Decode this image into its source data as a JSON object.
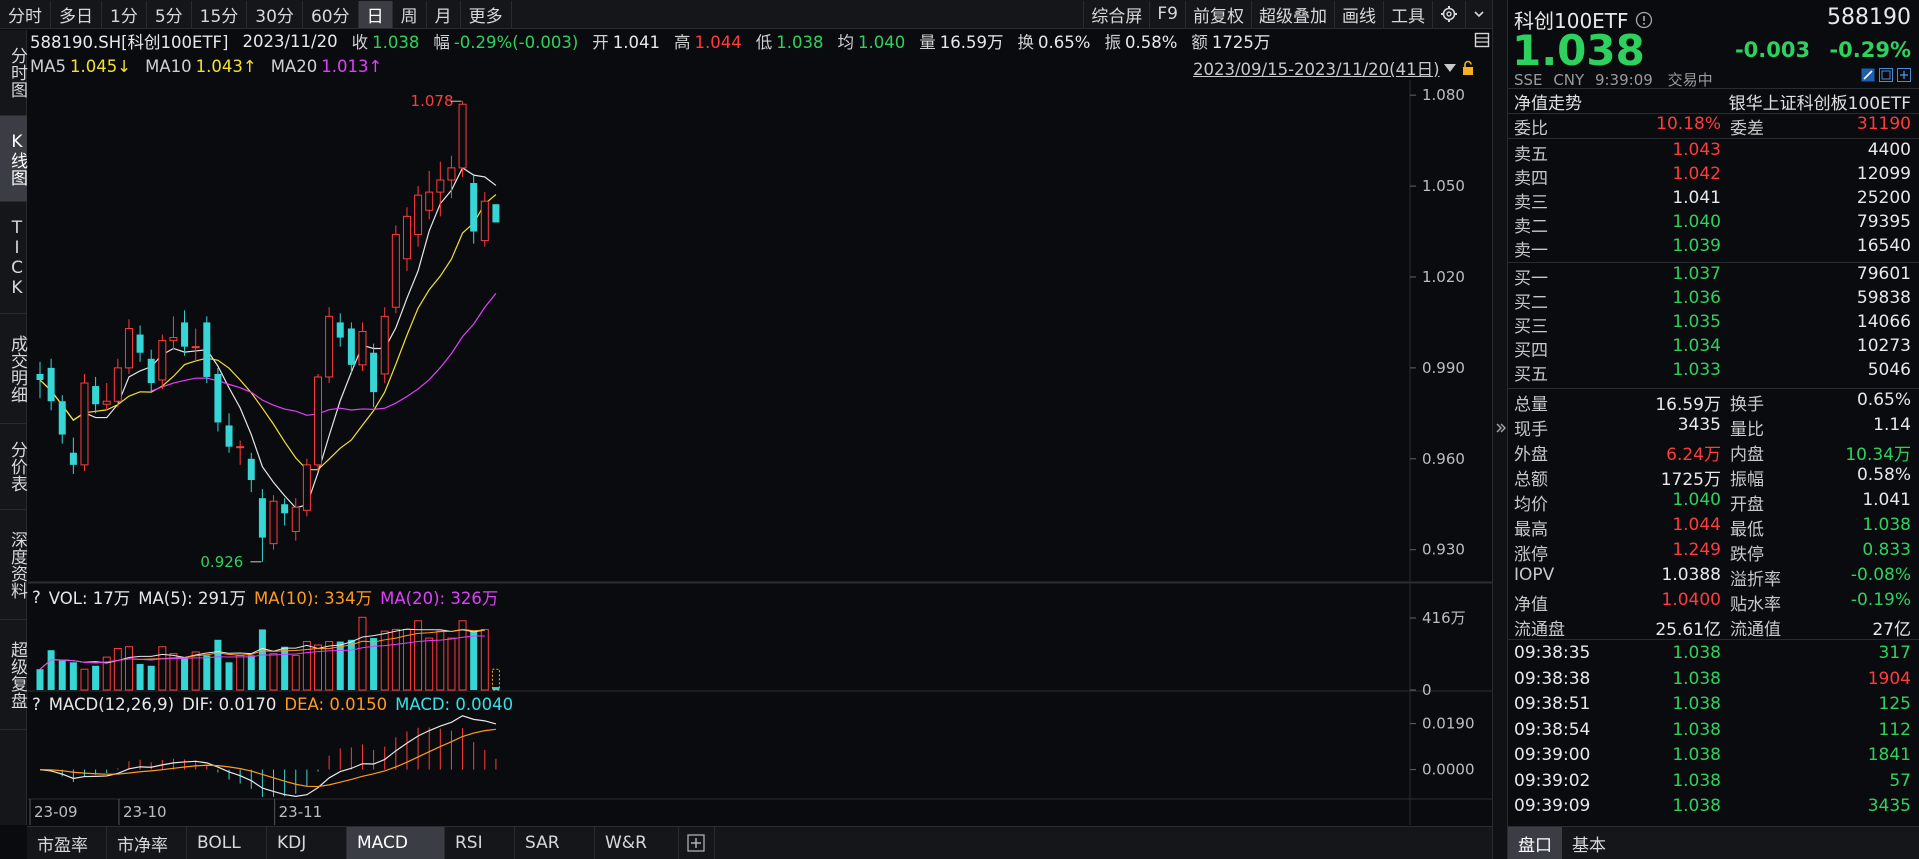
{
  "toolbar": {
    "periods": [
      "分时",
      "多日",
      "1分",
      "5分",
      "15分",
      "30分",
      "60分",
      "日",
      "周",
      "月",
      "更多"
    ],
    "active_period": "日",
    "tools": [
      "综合屏",
      "F9",
      "前复权",
      "超级叠加",
      "画线",
      "工具"
    ]
  },
  "left_tabs": [
    "分时图",
    "K线图",
    "TICK",
    "成交明细",
    "分价表",
    "深度资料",
    "超级复盘"
  ],
  "info": {
    "symbol": "588190.SH[科创100ETF]",
    "date": "2023/11/20",
    "close_label": "收",
    "close": "1.038",
    "change_label": "幅",
    "change": "-0.29%(-0.003)",
    "open_label": "开",
    "open": "1.041",
    "high_label": "高",
    "high": "1.044",
    "low_label": "低",
    "low": "1.038",
    "avg_label": "均",
    "avg": "1.040",
    "volume_label": "量",
    "volume": "16.59万",
    "turnover_label": "换",
    "turnover": "0.65%",
    "amp_label": "振",
    "amp": "0.58%",
    "amount_label": "额",
    "amount": "1725万"
  },
  "ma": {
    "ma5_label": "MA5",
    "ma5": "1.045↓",
    "ma10_label": "MA10",
    "ma10": "1.043↑",
    "ma20_label": "MA20",
    "ma20": "1.013↑"
  },
  "range_label": "2023/09/15-2023/11/20(41日)",
  "vol_info": {
    "q": "?",
    "vol": "VOL: 17万",
    "ma5": "MA(5): 291万",
    "ma10": "MA(10): 334万",
    "ma20": "MA(20): 326万"
  },
  "macd_info": {
    "q": "?",
    "title": "MACD(12,26,9)",
    "dif": "DIF: 0.0170",
    "dea": "DEA: 0.0150",
    "macd": "MACD: 0.0040"
  },
  "price_ticks": [
    "1.080",
    "1.050",
    "1.020",
    "0.990",
    "0.960",
    "0.930"
  ],
  "vol_ticks": [
    "416万",
    "0"
  ],
  "macd_ticks": [
    "0.0190",
    "0.0000"
  ],
  "date_ticks": [
    "23-09",
    "23-10",
    "23-11"
  ],
  "annotations": {
    "high": "1.078",
    "low": "0.926"
  },
  "chart_data": {
    "type": "candlestick",
    "title": "",
    "ylim": [
      0.92,
      1.085
    ],
    "candles": [
      {
        "o": 0.988,
        "c": 0.986,
        "h": 0.992,
        "l": 0.98
      },
      {
        "o": 0.99,
        "c": 0.979,
        "h": 0.993,
        "l": 0.976
      },
      {
        "o": 0.979,
        "c": 0.968,
        "h": 0.981,
        "l": 0.965
      },
      {
        "o": 0.962,
        "c": 0.958,
        "h": 0.967,
        "l": 0.955
      },
      {
        "o": 0.958,
        "c": 0.985,
        "h": 0.988,
        "l": 0.956
      },
      {
        "o": 0.984,
        "c": 0.978,
        "h": 0.987,
        "l": 0.975
      },
      {
        "o": 0.978,
        "c": 0.979,
        "h": 0.985,
        "l": 0.976
      },
      {
        "o": 0.979,
        "c": 0.99,
        "h": 0.993,
        "l": 0.977
      },
      {
        "o": 0.99,
        "c": 1.003,
        "h": 1.006,
        "l": 0.988
      },
      {
        "o": 1.001,
        "c": 0.995,
        "h": 1.004,
        "l": 0.992
      },
      {
        "o": 0.993,
        "c": 0.985,
        "h": 0.996,
        "l": 0.982
      },
      {
        "o": 0.986,
        "c": 0.999,
        "h": 1.001,
        "l": 0.983
      },
      {
        "o": 0.999,
        "c": 1.0,
        "h": 1.007,
        "l": 0.996
      },
      {
        "o": 1.005,
        "c": 0.997,
        "h": 1.009,
        "l": 0.994
      },
      {
        "o": 0.997,
        "c": 0.997,
        "h": 1.003,
        "l": 0.992
      },
      {
        "o": 1.005,
        "c": 0.987,
        "h": 1.007,
        "l": 0.985
      },
      {
        "o": 0.988,
        "c": 0.972,
        "h": 0.99,
        "l": 0.969
      },
      {
        "o": 0.971,
        "c": 0.964,
        "h": 0.975,
        "l": 0.962
      },
      {
        "o": 0.964,
        "c": 0.964,
        "h": 0.966,
        "l": 0.958
      },
      {
        "o": 0.96,
        "c": 0.953,
        "h": 0.962,
        "l": 0.949
      },
      {
        "o": 0.947,
        "c": 0.934,
        "h": 0.95,
        "l": 0.926
      },
      {
        "o": 0.932,
        "c": 0.946,
        "h": 0.948,
        "l": 0.93
      },
      {
        "o": 0.945,
        "c": 0.942,
        "h": 0.947,
        "l": 0.938
      },
      {
        "o": 0.936,
        "c": 0.944,
        "h": 0.947,
        "l": 0.933
      },
      {
        "o": 0.943,
        "c": 0.958,
        "h": 0.96,
        "l": 0.941
      },
      {
        "o": 0.958,
        "c": 0.987,
        "h": 0.988,
        "l": 0.956
      },
      {
        "o": 0.987,
        "c": 1.007,
        "h": 1.01,
        "l": 0.985
      },
      {
        "o": 1.005,
        "c": 1.0,
        "h": 1.008,
        "l": 0.997
      },
      {
        "o": 1.003,
        "c": 0.991,
        "h": 1.005,
        "l": 0.988
      },
      {
        "o": 0.991,
        "c": 1.002,
        "h": 1.005,
        "l": 0.989
      },
      {
        "o": 0.995,
        "c": 0.982,
        "h": 0.998,
        "l": 0.977
      },
      {
        "o": 0.988,
        "c": 1.007,
        "h": 1.01,
        "l": 0.985
      },
      {
        "o": 1.01,
        "c": 1.034,
        "h": 1.037,
        "l": 1.008
      },
      {
        "o": 1.026,
        "c": 1.04,
        "h": 1.043,
        "l": 1.022
      },
      {
        "o": 1.034,
        "c": 1.047,
        "h": 1.05,
        "l": 1.03
      },
      {
        "o": 1.042,
        "c": 1.048,
        "h": 1.055,
        "l": 1.039
      },
      {
        "o": 1.048,
        "c": 1.052,
        "h": 1.058,
        "l": 1.04
      },
      {
        "o": 1.052,
        "c": 1.056,
        "h": 1.06,
        "l": 1.046
      },
      {
        "o": 1.056,
        "c": 1.077,
        "h": 1.078,
        "l": 1.053
      },
      {
        "o": 1.051,
        "c": 1.035,
        "h": 1.054,
        "l": 1.031
      },
      {
        "o": 1.032,
        "c": 1.045,
        "h": 1.048,
        "l": 1.03
      },
      {
        "o": 1.044,
        "c": 1.038,
        "h": 1.044,
        "l": 1.038
      }
    ],
    "volume": [
      1.2,
      2.3,
      1.7,
      1.6,
      1.2,
      1.4,
      1.9,
      2.4,
      2.5,
      1.5,
      1.4,
      2.5,
      2.1,
      1.9,
      2.2,
      2.0,
      2.9,
      1.6,
      2.0,
      2.0,
      3.5,
      2.1,
      2.5,
      2.0,
      2.8,
      2.6,
      2.8,
      2.8,
      2.9,
      4.2,
      3.0,
      3.4,
      3.5,
      3.5,
      4.0,
      3.0,
      3.4,
      3.0,
      4.0,
      3.4,
      3.5,
      0.17
    ]
  },
  "right_panel": {
    "name": "科创100ETF",
    "code": "588190",
    "price": "1.038",
    "change": "-0.003",
    "change_pct": "-0.29%",
    "exchange": "SSE",
    "currency": "CNY",
    "time": "9:39:09",
    "status": "交易中",
    "nav_trend": "净值走势",
    "fund_name": "银华上证科创板100ETF",
    "weibi_label": "委比",
    "weibi": "10.18%",
    "weicha_label": "委差",
    "weicha": "31190",
    "asks": [
      {
        "label": "卖五",
        "price": "1.043",
        "vol": "4400"
      },
      {
        "label": "卖四",
        "price": "1.042",
        "vol": "12099"
      },
      {
        "label": "卖三",
        "price": "1.041",
        "vol": "25200"
      },
      {
        "label": "卖二",
        "price": "1.040",
        "vol": "79395"
      },
      {
        "label": "卖一",
        "price": "1.039",
        "vol": "16540"
      }
    ],
    "bids": [
      {
        "label": "买一",
        "price": "1.037",
        "vol": "79601"
      },
      {
        "label": "买二",
        "price": "1.036",
        "vol": "59838"
      },
      {
        "label": "买三",
        "price": "1.035",
        "vol": "14066"
      },
      {
        "label": "买四",
        "price": "1.034",
        "vol": "10273"
      },
      {
        "label": "买五",
        "price": "1.033",
        "vol": "5046"
      }
    ],
    "stats": [
      {
        "l1": "总量",
        "v1": "16.59万",
        "l2": "换手",
        "v2": "0.65%"
      },
      {
        "l1": "现手",
        "v1": "3435",
        "l2": "量比",
        "v2": "1.14"
      },
      {
        "l1": "外盘",
        "v1": "6.24万",
        "l2": "内盘",
        "v2": "10.34万"
      },
      {
        "l1": "总额",
        "v1": "1725万",
        "l2": "振幅",
        "v2": "0.58%"
      },
      {
        "l1": "均价",
        "v1": "1.040",
        "l2": "开盘",
        "v2": "1.041"
      },
      {
        "l1": "最高",
        "v1": "1.044",
        "l2": "最低",
        "v2": "1.038"
      },
      {
        "l1": "涨停",
        "v1": "1.249",
        "l2": "跌停",
        "v2": "0.833"
      },
      {
        "l1": "IOPV",
        "v1": "1.0388",
        "l2": "溢折率",
        "v2": "-0.08%"
      },
      {
        "l1": "净值",
        "v1": "1.0400",
        "l2": "贴水率",
        "v2": "-0.19%"
      },
      {
        "l1": "流通盘",
        "v1": "25.61亿",
        "l2": "流通值",
        "v2": "27亿"
      }
    ],
    "ticks": [
      {
        "t": "09:38:35",
        "p": "1.038",
        "v": "317"
      },
      {
        "t": "09:38:38",
        "p": "1.038",
        "v": "1904"
      },
      {
        "t": "09:38:51",
        "p": "1.038",
        "v": "125"
      },
      {
        "t": "09:38:54",
        "p": "1.038",
        "v": "112"
      },
      {
        "t": "09:39:00",
        "p": "1.038",
        "v": "1841"
      },
      {
        "t": "09:39:02",
        "p": "1.038",
        "v": "57"
      },
      {
        "t": "09:39:09",
        "p": "1.038",
        "v": "3435"
      }
    ],
    "bottom_tabs": [
      "盘口",
      "基本"
    ]
  },
  "bottom_tabs": [
    "市盈率",
    "市净率",
    "BOLL",
    "KDJ",
    "MACD",
    "RSI",
    "SAR",
    "W&R"
  ],
  "active_bottom_tab": "MACD",
  "colors": {
    "up": "#ff3b3b",
    "down": "#36d6d6",
    "ma5": "#e8e8e8",
    "ma10": "#f2e22f",
    "ma20": "#e040fb",
    "bg": "#0a0b0e"
  }
}
